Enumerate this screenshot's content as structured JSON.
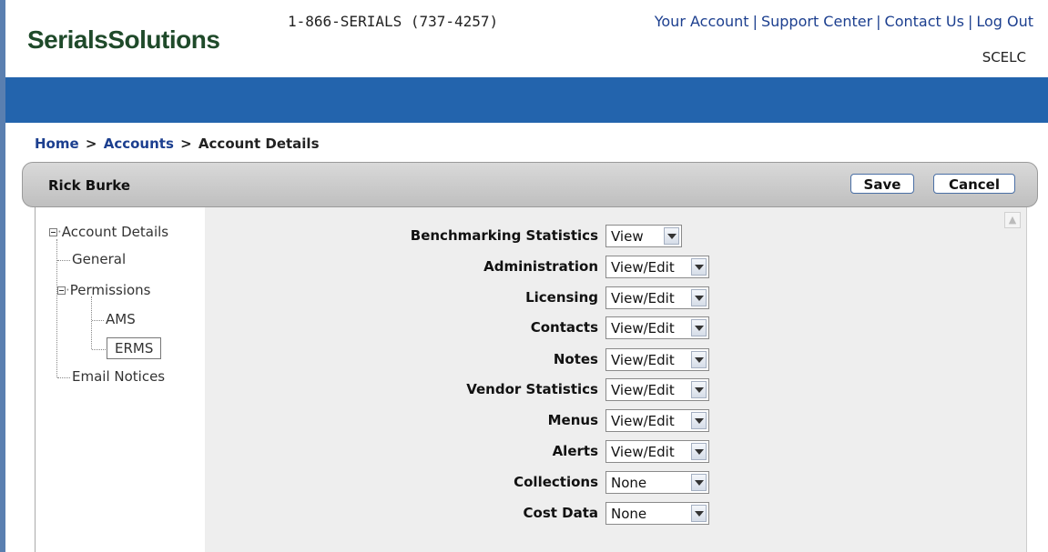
{
  "header": {
    "logo_text": "SerialsSolutions",
    "phone": "1-866-SERIALS (737-4257)",
    "links": [
      "Your Account",
      "Support Center",
      "Contact Us",
      "Log Out"
    ],
    "organization": "SCELC"
  },
  "breadcrumb": {
    "home": "Home",
    "accounts": "Accounts",
    "current": "Account Details",
    "separator": ">"
  },
  "titlebar": {
    "name": "Rick Burke",
    "save_label": "Save",
    "cancel_label": "Cancel"
  },
  "tree": {
    "root": "Account Details",
    "general": "General",
    "permissions": "Permissions",
    "ams": "AMS",
    "erms": "ERMS",
    "email_notices": "Email Notices"
  },
  "permissions": [
    {
      "label": "Benchmarking Statistics",
      "value": "View"
    },
    {
      "label": "Administration",
      "value": "View/Edit"
    },
    {
      "label": "Licensing",
      "value": "View/Edit"
    },
    {
      "label": "Contacts",
      "value": "View/Edit"
    },
    {
      "label": "Notes",
      "value": "View/Edit"
    },
    {
      "label": "Vendor Statistics",
      "value": "View/Edit"
    },
    {
      "label": "Menus",
      "value": "View/Edit"
    },
    {
      "label": "Alerts",
      "value": "View/Edit"
    },
    {
      "label": "Collections",
      "value": "None"
    },
    {
      "label": "Cost Data",
      "value": "None"
    }
  ],
  "colors": {
    "brand_blue": "#2364ad",
    "link_blue": "#1c3f8f",
    "logo_green": "#1f4a2a"
  }
}
